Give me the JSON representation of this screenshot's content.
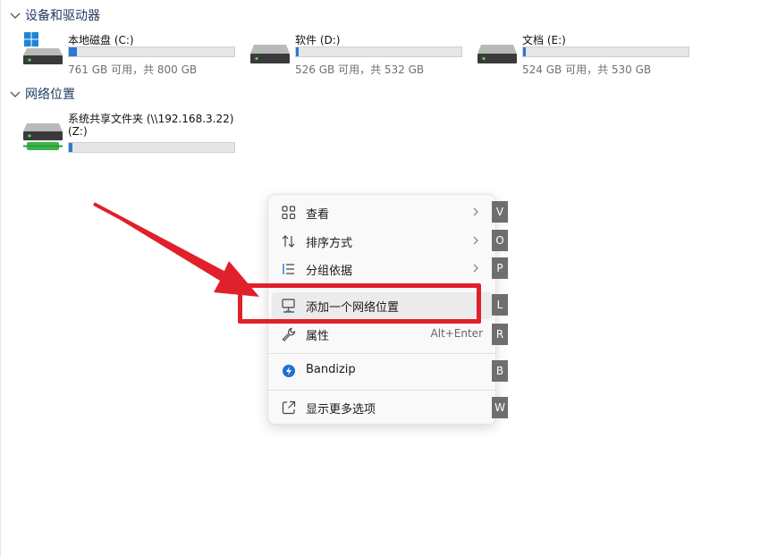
{
  "sections": {
    "devices": {
      "title": "设备和驱动器"
    },
    "network": {
      "title": "网络位置"
    }
  },
  "drives": [
    {
      "name": "本地磁盘 (C:)",
      "free": "761 GB 可用，共 800 GB",
      "used_fraction": 0.05,
      "icon": "windows-drive-icon"
    },
    {
      "name": "软件 (D:)",
      "free": "526 GB 可用，共 532 GB",
      "used_fraction": 0.01,
      "icon": "drive-icon"
    },
    {
      "name": "文档 (E:)",
      "free": "524 GB 可用，共 530 GB",
      "used_fraction": 0.01,
      "icon": "drive-icon"
    }
  ],
  "network_drive": {
    "name_line1": "系统共享文件夹 (\\\\192.168.3.22)",
    "name_line2": "(Z:)",
    "used_fraction": 0.02,
    "icon": "network-drive-icon"
  },
  "context_menu": {
    "items": [
      {
        "label": "查看",
        "icon": "grid-icon",
        "submenu": true,
        "access_key": "V"
      },
      {
        "label": "排序方式",
        "icon": "sort-icon",
        "submenu": true,
        "access_key": "O"
      },
      {
        "label": "分组依据",
        "icon": "group-by-icon",
        "submenu": true,
        "access_key": "P"
      },
      {
        "label": "添加一个网络位置",
        "icon": "monitor-network-icon",
        "submenu": false,
        "access_key": "L",
        "highlighted": true
      },
      {
        "label": "属性",
        "icon": "wrench-icon",
        "shortcut": "Alt+Enter",
        "access_key": "R"
      },
      {
        "label": "Bandizip",
        "icon": "bandizip-icon",
        "access_key": "B"
      },
      {
        "label": "显示更多选项",
        "icon": "open-external-icon",
        "access_key": "W"
      }
    ]
  },
  "colors": {
    "accent": "#2b78d6",
    "annotation_red": "#e0202a",
    "section_title": "#1f3a5f"
  }
}
